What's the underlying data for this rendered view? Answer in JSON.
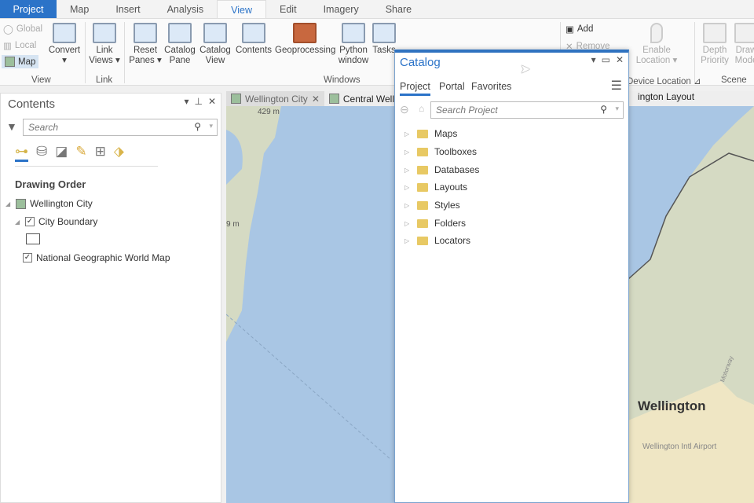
{
  "ribbon_tabs": [
    "Project",
    "Map",
    "Insert",
    "Analysis",
    "View",
    "Edit",
    "Imagery",
    "Share"
  ],
  "active_tab": "View",
  "view_group": {
    "global": "Global",
    "local": "Local",
    "map": "Map",
    "convert": "Convert",
    "label": "View"
  },
  "link_group": {
    "link_views": "Link Views",
    "label": "Link"
  },
  "windows_group": {
    "reset_panes": "Reset Panes",
    "catalog_pane": "Catalog Pane",
    "catalog_view": "Catalog View",
    "contents": "Contents",
    "geoprocessing": "Geoprocessing",
    "python_window": "Python window",
    "tasks": "Tasks",
    "label": "Windows"
  },
  "device_group": {
    "add": "Add",
    "remove": "Remove",
    "enable_location": "Enable Location",
    "label": "Device Location"
  },
  "scene_group": {
    "depth_priority": "Depth Priority",
    "draw_mode": "Draw Mode",
    "label": "Scene"
  },
  "contents": {
    "title": "Contents",
    "search_placeholder": "Search",
    "section": "Drawing Order",
    "map": "Wellington City",
    "layers": [
      {
        "name": "City Boundary",
        "checked": true
      },
      {
        "name": "National Geographic World Map",
        "checked": true
      }
    ]
  },
  "doc_tabs": [
    "Wellington City",
    "Central Welli",
    "ington Layout"
  ],
  "map_labels": {
    "elev1": "429 m",
    "elev2": "9 m",
    "city": "Wellington",
    "airport": "Wellington Intl Airport",
    "road": "Motorway"
  },
  "catalog": {
    "title": "Catalog",
    "tabs": [
      "Project",
      "Portal",
      "Favorites"
    ],
    "active": "Project",
    "search_placeholder": "Search Project",
    "items": [
      "Maps",
      "Toolboxes",
      "Databases",
      "Layouts",
      "Styles",
      "Folders",
      "Locators"
    ]
  },
  "colors": {
    "accent": "#2b73c8",
    "water": "#a9c6e4",
    "land": "#d9ddc8"
  }
}
